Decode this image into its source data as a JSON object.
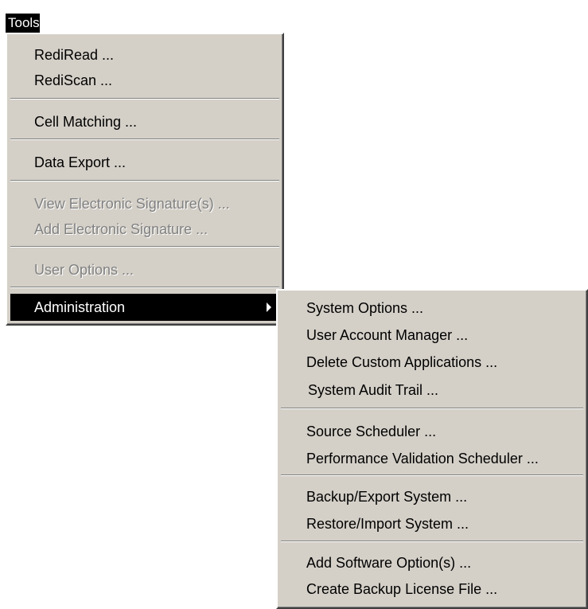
{
  "menubar": {
    "tools_label": "Tools"
  },
  "tools_menu": {
    "items": [
      {
        "label": "RediRead ..."
      },
      {
        "label": "RediScan ..."
      },
      {
        "label": "Cell Matching ..."
      },
      {
        "label": "Data Export ..."
      },
      {
        "label": "View Electronic Signature(s) ..."
      },
      {
        "label": "Add Electronic Signature ..."
      },
      {
        "label": "User Options ..."
      },
      {
        "label": "Administration"
      }
    ]
  },
  "admin_menu": {
    "items": [
      {
        "label": "System Options ..."
      },
      {
        "label": "User Account Manager  ..."
      },
      {
        "label": "Delete Custom Applications ..."
      },
      {
        "label": "System Audit Trail ..."
      },
      {
        "label": "Source Scheduler ..."
      },
      {
        "label": "Performance Validation Scheduler ..."
      },
      {
        "label": "Backup/Export System ..."
      },
      {
        "label": "Restore/Import System ..."
      },
      {
        "label": "Add Software Option(s) ..."
      },
      {
        "label": "Create Backup License File ..."
      }
    ]
  },
  "colors": {
    "menu_bg": "#d4d0c8",
    "highlight": "#000000",
    "disabled_text": "#808080"
  }
}
